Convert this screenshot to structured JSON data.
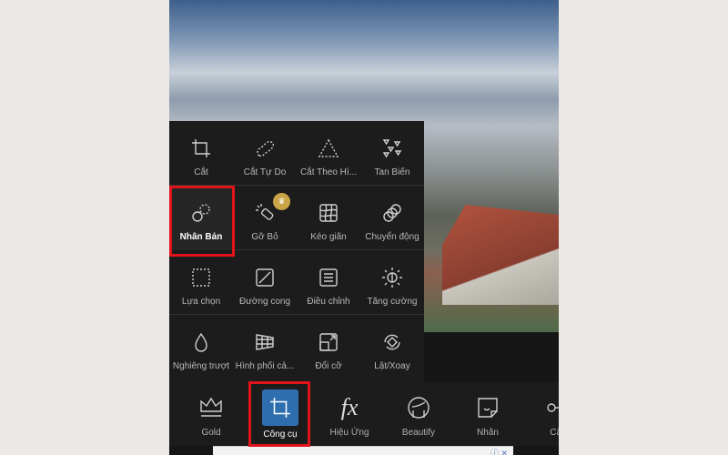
{
  "tools_panel": {
    "rows": [
      [
        {
          "label": "Cắt",
          "icon": "crop-icon"
        },
        {
          "label": "Cắt Tự Do",
          "icon": "free-crop-icon"
        },
        {
          "label": "Cắt Theo Hì...",
          "icon": "shape-crop-icon"
        },
        {
          "label": "Tan Biến",
          "icon": "dispersion-icon"
        }
      ],
      [
        {
          "label": "Nhân Bản",
          "icon": "clone-icon",
          "selected": true
        },
        {
          "label": "Gỡ Bỏ",
          "icon": "remove-icon",
          "premium": true
        },
        {
          "label": "Kéo giãn",
          "icon": "stretch-icon"
        },
        {
          "label": "Chuyển động",
          "icon": "motion-icon"
        }
      ],
      [
        {
          "label": "Lựa chọn",
          "icon": "selection-icon"
        },
        {
          "label": "Đường cong",
          "icon": "curves-icon"
        },
        {
          "label": "Điều chỉnh",
          "icon": "adjust-icon"
        },
        {
          "label": "Tăng cường",
          "icon": "enhance-icon"
        }
      ],
      [
        {
          "label": "Nghiêng trượt",
          "icon": "tilt-shift-icon"
        },
        {
          "label": "Hình phối cả...",
          "icon": "perspective-icon"
        },
        {
          "label": "Đổi cỡ",
          "icon": "resize-icon"
        },
        {
          "label": "Lật/Xoay",
          "icon": "flip-rotate-icon"
        }
      ]
    ]
  },
  "bottom_bar": {
    "items": [
      {
        "label": "Gold",
        "icon": "crown-icon"
      },
      {
        "label": "Công cụ",
        "icon": "crop-icon",
        "selected": true
      },
      {
        "label": "Hiệu Ứng",
        "icon": "fx-icon",
        "glyph": "fx"
      },
      {
        "label": "Beautify",
        "icon": "face-icon"
      },
      {
        "label": "Nhãn",
        "icon": "sticker-icon"
      },
      {
        "label": "Cắt",
        "icon": "cutout-icon"
      }
    ]
  },
  "colors": {
    "highlight": "#e1141b",
    "accent": "#2f6fb0",
    "premium": "#c9a548"
  }
}
